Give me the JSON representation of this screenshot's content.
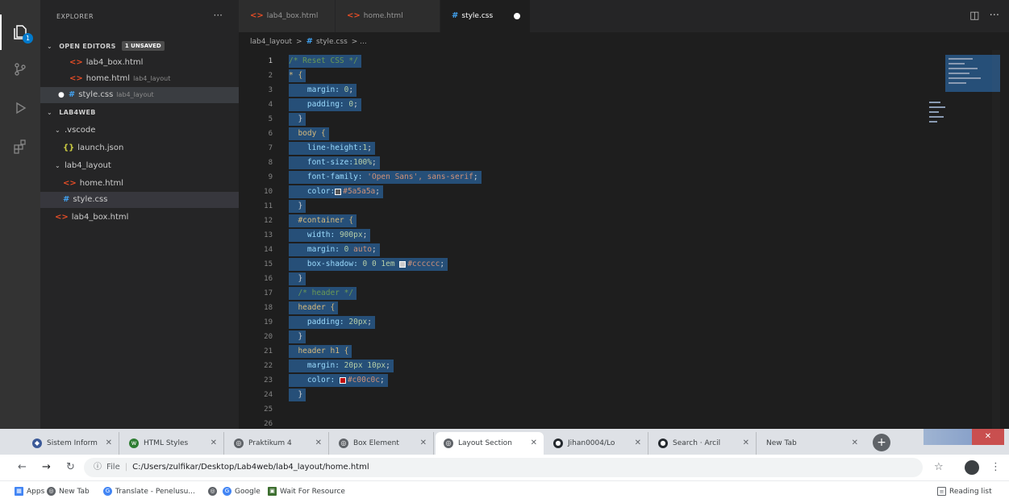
{
  "vscode": {
    "activity": {
      "explorer_icon": "files-icon",
      "explorer_badge": "1",
      "scm_icon": "source-control-icon",
      "debug_icon": "run-debug-icon",
      "extensions_icon": "extensions-icon"
    },
    "sidebar": {
      "title": "EXPLORER",
      "more": "···",
      "open_editors": {
        "title": "OPEN EDITORS",
        "badge": "1 UNSAVED",
        "items": [
          {
            "name": "lab4_box.html",
            "dir": ""
          },
          {
            "name": "home.html",
            "dir": "lab4_layout"
          },
          {
            "name": "style.css",
            "dir": "lab4_layout"
          }
        ]
      },
      "workspace": {
        "title": "LAB4WEB",
        "vscode_folder": ".vscode",
        "launch_json": "launch.json",
        "layout_folder": "lab4_layout",
        "home_html": "home.html",
        "style_css": "style.css",
        "box_html": "lab4_box.html"
      }
    },
    "tabs": [
      {
        "label": "lab4_box.html"
      },
      {
        "label": "home.html"
      },
      {
        "label": "style.css"
      }
    ],
    "breadcrumb": {
      "folder": "lab4_layout",
      "sep": ">",
      "file": "style.css",
      "symbol": "> ..."
    },
    "line_numbers": [
      "1",
      "2",
      "3",
      "4",
      "5",
      "6",
      "7",
      "8",
      "9",
      "10",
      "11",
      "12",
      "13",
      "14",
      "15",
      "16",
      "17",
      "18",
      "19",
      "20",
      "21",
      "22",
      "23",
      "24",
      "25",
      "26"
    ],
    "code": {
      "l1": "/* Reset CSS */",
      "l2_sel": "* {",
      "l3_prop": "margin:",
      "l3_val": "0",
      "l3_end": ";",
      "l4_prop": "padding:",
      "l4_val": "0",
      "l4_end": ";",
      "l5": "}",
      "l6_sel": "body {",
      "l7_prop": "line-height:",
      "l7_val": "1",
      "l7_end": ";",
      "l8_prop": "font-size:",
      "l8_val": "100%",
      "l8_end": ";",
      "l9_prop": "font-family:",
      "l9_str": "'Open Sans'",
      "l9_rest": ", sans-serif",
      "l9_end": ";",
      "l10_prop": "color:",
      "l10_val": "#5a5a5a",
      "l10_end": ";",
      "l11": "}",
      "l12_sel": "#container {",
      "l13_prop": "width:",
      "l13_val": "900px",
      "l13_end": ";",
      "l14_prop": "margin:",
      "l14_val": "0",
      "l14_rest": "auto",
      "l14_end": ";",
      "l15_prop": "box-shadow:",
      "l15_val": "0 0 1em",
      "l15_col": "#cccccc",
      "l15_end": ";",
      "l16": "}",
      "l17": "/* header */",
      "l18_sel": "header {",
      "l19_prop": "padding:",
      "l19_val": "20px",
      "l19_end": ";",
      "l20": "}",
      "l21_sel": "header h1 {",
      "l22_prop": "margin:",
      "l22_val": "20px 10px",
      "l22_end": ";",
      "l23_prop": "color:",
      "l23_val": "#c00c0c",
      "l23_end": ";",
      "l24": "}"
    },
    "editor_actions": {
      "split": "◫",
      "more": "···"
    },
    "colors": {
      "swatch_body": "#5a5a5a",
      "swatch_shadow": "#cccccc",
      "swatch_h1": "#c00c0c"
    }
  },
  "chrome": {
    "tabs": [
      {
        "label": "Sistem Inform",
        "icon": "apple-icon"
      },
      {
        "label": "HTML Styles",
        "icon": "w3schools-icon"
      },
      {
        "label": "Praktikum 4",
        "icon": "globe-icon"
      },
      {
        "label": "Box Element",
        "icon": "globe-icon"
      },
      {
        "label": "Layout Section",
        "icon": "globe-icon"
      },
      {
        "label": "Jihan0004/Lo",
        "icon": "github-icon"
      },
      {
        "label": "Search · Arcil",
        "icon": "github-icon"
      },
      {
        "label": "New Tab",
        "icon": ""
      }
    ],
    "newtab": "+",
    "close": "✕",
    "omnibox": {
      "scheme": "File",
      "url": "C:/Users/zulfikar/Desktop/Lab4web/lab4_layout/home.html"
    },
    "bookmarks": [
      {
        "label": "Apps"
      },
      {
        "label": "New Tab"
      },
      {
        "label": "Translate - Penelusu..."
      },
      {
        "label": ""
      },
      {
        "label": "Google"
      },
      {
        "label": "Wait For Resource"
      }
    ],
    "reading_list": "Reading list"
  }
}
